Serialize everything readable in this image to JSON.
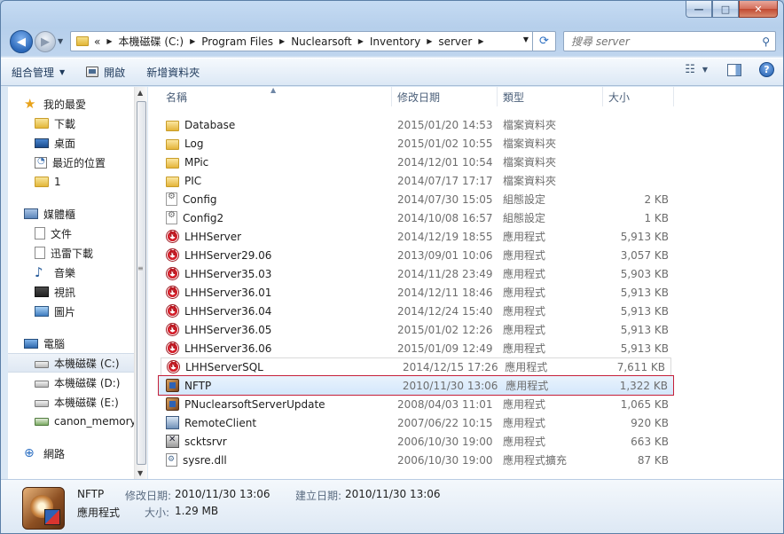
{
  "window": {
    "minimize": "—",
    "maximize": "□",
    "close": "✕"
  },
  "address": {
    "overflow": "«",
    "crumbs": [
      "本機磁碟 (C:)",
      "Program Files",
      "Nuclearsoft",
      "Inventory",
      "server"
    ]
  },
  "search": {
    "placeholder": "搜尋 server"
  },
  "toolbar": {
    "organize": "組合管理",
    "open": "開啟",
    "new_folder": "新增資料夾"
  },
  "sidebar": {
    "favorites": {
      "label": "我的最愛",
      "items": [
        "下載",
        "桌面",
        "最近的位置",
        "1"
      ]
    },
    "libraries": {
      "label": "媒體櫃",
      "items": [
        "文件",
        "迅雷下載",
        "音樂",
        "視訊",
        "圖片"
      ]
    },
    "computer": {
      "label": "電腦",
      "items": [
        "本機磁碟 (C:)",
        "本機磁碟 (D:)",
        "本機磁碟 (E:)",
        "canon_memory"
      ]
    },
    "network": {
      "label": "網路"
    }
  },
  "columns": {
    "name": "名稱",
    "date": "修改日期",
    "type": "類型",
    "size": "大小"
  },
  "files": [
    {
      "name": "Database",
      "date": "2015/01/20 14:53",
      "type": "檔案資料夾",
      "size": "",
      "icon": "folder-icon"
    },
    {
      "name": "Log",
      "date": "2015/01/02 10:55",
      "type": "檔案資料夾",
      "size": "",
      "icon": "folder-icon"
    },
    {
      "name": "MPic",
      "date": "2014/12/01 10:54",
      "type": "檔案資料夾",
      "size": "",
      "icon": "folder-icon"
    },
    {
      "name": "PIC",
      "date": "2014/07/17 17:17",
      "type": "檔案資料夾",
      "size": "",
      "icon": "folder-icon"
    },
    {
      "name": "Config",
      "date": "2014/07/30 15:05",
      "type": "組態設定",
      "size": "2 KB",
      "icon": "config-file-icon"
    },
    {
      "name": "Config2",
      "date": "2014/10/08 16:57",
      "type": "組態設定",
      "size": "1 KB",
      "icon": "config-file-icon"
    },
    {
      "name": "LHHServer",
      "date": "2014/12/19 18:55",
      "type": "應用程式",
      "size": "5,913 KB",
      "icon": "app-icon"
    },
    {
      "name": "LHHServer29.06",
      "date": "2013/09/01 10:06",
      "type": "應用程式",
      "size": "3,057 KB",
      "icon": "app-icon"
    },
    {
      "name": "LHHServer35.03",
      "date": "2014/11/28 23:49",
      "type": "應用程式",
      "size": "5,903 KB",
      "icon": "app-icon"
    },
    {
      "name": "LHHServer36.01",
      "date": "2014/12/11 18:46",
      "type": "應用程式",
      "size": "5,913 KB",
      "icon": "app-icon"
    },
    {
      "name": "LHHServer36.04",
      "date": "2014/12/24 15:40",
      "type": "應用程式",
      "size": "5,913 KB",
      "icon": "app-icon"
    },
    {
      "name": "LHHServer36.05",
      "date": "2015/01/02 12:26",
      "type": "應用程式",
      "size": "5,913 KB",
      "icon": "app-icon"
    },
    {
      "name": "LHHServer36.06",
      "date": "2015/01/09 12:49",
      "type": "應用程式",
      "size": "5,913 KB",
      "icon": "app-icon"
    },
    {
      "name": "LHHServerSQL",
      "date": "2014/12/15 17:26",
      "type": "應用程式",
      "size": "7,611 KB",
      "icon": "app-icon"
    },
    {
      "name": "NFTP",
      "date": "2010/11/30 13:06",
      "type": "應用程式",
      "size": "1,322 KB",
      "icon": "nftp-icon"
    },
    {
      "name": "PNuclearsoftServerUpdate",
      "date": "2008/04/03 11:01",
      "type": "應用程式",
      "size": "1,065 KB",
      "icon": "updater-icon"
    },
    {
      "name": "RemoteClient",
      "date": "2007/06/22 10:15",
      "type": "應用程式",
      "size": "920 KB",
      "icon": "remote-client-icon"
    },
    {
      "name": "scktsrvr",
      "date": "2006/10/30 19:00",
      "type": "應用程式",
      "size": "663 KB",
      "icon": "socket-server-icon"
    },
    {
      "name": "sysre.dll",
      "date": "2006/10/30 19:00",
      "type": "應用程式擴充",
      "size": "87 KB",
      "icon": "dll-icon"
    }
  ],
  "details": {
    "name": "NFTP",
    "type": "應用程式",
    "modified_label": "修改日期:",
    "modified": "2010/11/30 13:06",
    "created_label": "建立日期:",
    "created": "2010/11/30 13:06",
    "size_label": "大小:",
    "size": "1.29 MB"
  },
  "colors": {
    "selection_border": "#c5203a",
    "window_frame": "#b9d1ec"
  }
}
